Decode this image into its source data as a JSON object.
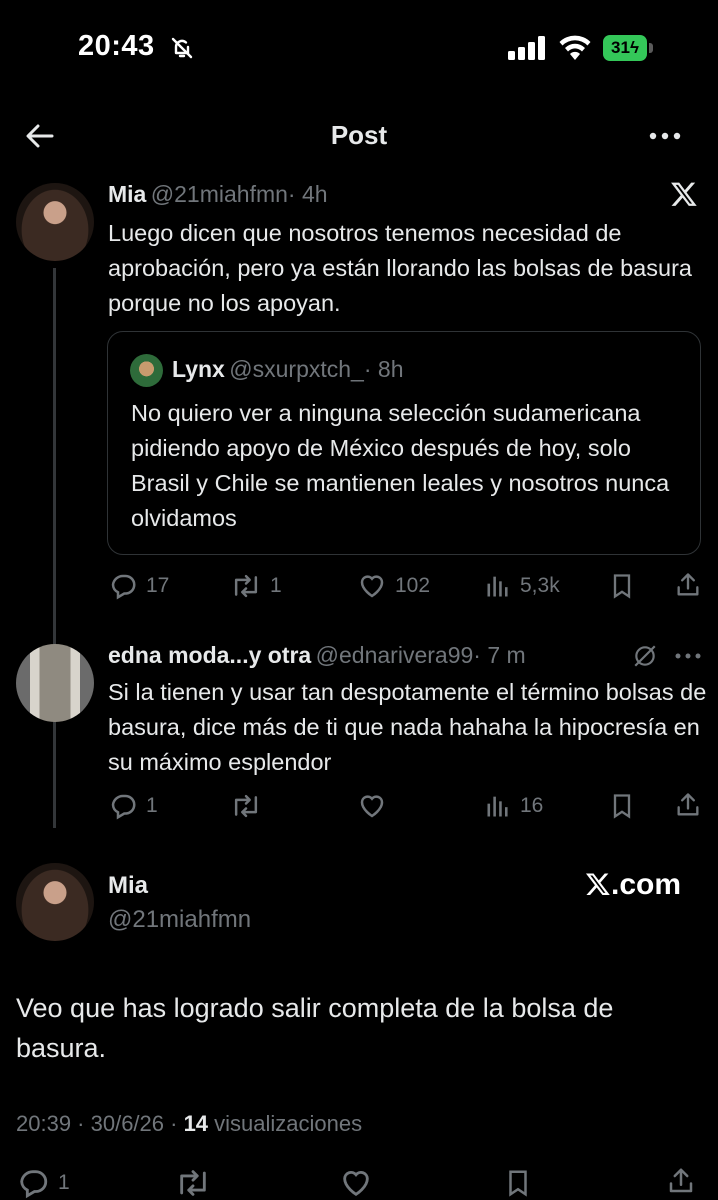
{
  "status_bar": {
    "time": "20:43",
    "battery": "31"
  },
  "header": {
    "title": "Post"
  },
  "tweet1": {
    "name": "Mia",
    "handle": "@21miahfmn",
    "time": "· 4h",
    "text": "Luego dicen que nosotros tenemos necesidad de aprobación, pero ya están llorando las bolsas de basura porque no los apoyan.",
    "quote": {
      "name": "Lynx",
      "handle": "@sxurpxtch_",
      "time": "· 8h",
      "text": "No quiero ver a ninguna selección sudamericana pidiendo apoyo de México después de hoy, solo Brasil y Chile se mantienen leales y nosotros nunca olvidamos"
    },
    "metrics": {
      "replies": "17",
      "retweets": "1",
      "likes": "102",
      "views": "5,3k"
    }
  },
  "tweet2": {
    "name": "edna moda...y otra",
    "handle": "@ednarivera99",
    "time": "· 7 m",
    "text": "Si la tienen y usar tan despotamente el término bolsas de basura, dice más de ti que nada hahaha la hipocresía en su máximo esplendor",
    "metrics": {
      "replies": "1",
      "views": "16"
    }
  },
  "main_tweet": {
    "name": "Mia",
    "handle": "@21miahfmn",
    "watermark": ".com",
    "text": "Veo que has logrado salir completa de la bolsa de basura.",
    "timestamp": "20:39 · 30/6/26 · ",
    "views_count": "14",
    "views_label": " visualizaciones",
    "metrics": {
      "replies": "1"
    }
  },
  "colors": {
    "background": "#000000",
    "text": "#e7e9ea",
    "muted": "#71767b",
    "border": "#2f3336",
    "battery": "#34c759"
  },
  "icons": [
    "bell-slash-icon",
    "signal-icon",
    "wifi-icon",
    "back-arrow-icon",
    "more-icon",
    "x-logo-icon",
    "reply-icon",
    "retweet-icon",
    "like-icon",
    "views-icon",
    "bookmark-icon",
    "share-icon",
    "grok-icon"
  ]
}
